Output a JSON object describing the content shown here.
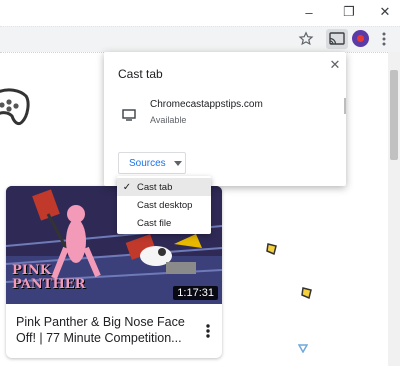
{
  "window": {
    "minimize_label": "–",
    "maximize_label": "❐",
    "close_label": "✕"
  },
  "toolbar": {
    "bookmark_icon": "star-icon",
    "cast_icon": "cast-icon",
    "profile_icon": "profile-icon",
    "menu_icon": "more-vert-icon"
  },
  "cast_dialog": {
    "title": "Cast tab",
    "close_label": "✕",
    "device": {
      "name": "Chromecastappstips.com",
      "status": "Available"
    },
    "sources_label": "Sources"
  },
  "sources_menu": {
    "items": [
      {
        "label": "Cast tab",
        "selected": true
      },
      {
        "label": "Cast desktop",
        "selected": false
      },
      {
        "label": "Cast file",
        "selected": false
      }
    ]
  },
  "video": {
    "duration": "1:17:31",
    "title": "Pink Panther & Big Nose Face Off! | 77 Minute Competition...",
    "thumbnail_caption": "PINK PANTHER"
  },
  "colors": {
    "accent": "#1a73e8",
    "panther_pink": "#f29ab8",
    "spark": "#f4d03f"
  }
}
